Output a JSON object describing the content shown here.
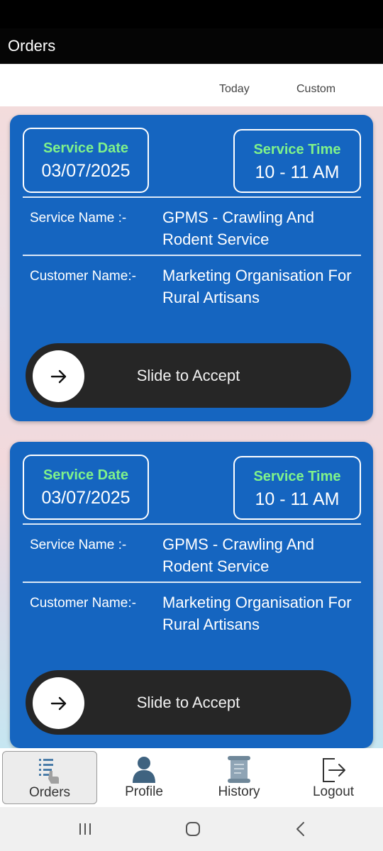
{
  "app_bar": {
    "title": "Orders"
  },
  "filters": {
    "today": "Today",
    "custom": "Custom"
  },
  "orders": [
    {
      "service_date_label": "Service Date",
      "service_date": "03/07/2025",
      "service_time_label": "Service Time",
      "service_time": "10 - 11 AM",
      "service_name_label": "Service Name :-",
      "service_name": "GPMS - Crawling And Rodent Service",
      "customer_name_label": "Customer Name:-",
      "customer_name": "Marketing Organisation For Rural Artisans",
      "slider_label": "Slide to Accept",
      "slider_icon": "arrow-right-icon"
    },
    {
      "service_date_label": "Service Date",
      "service_date": "03/07/2025",
      "service_time_label": "Service Time",
      "service_time": "10 - 11 AM",
      "service_name_label": "Service Name :-",
      "service_name": "GPMS - Crawling And Rodent Service",
      "customer_name_label": "Customer Name:-",
      "customer_name": "Marketing Organisation For Rural Artisans",
      "slider_label": "Slide to Accept",
      "slider_icon": "arrow-right-icon"
    }
  ],
  "bottom_nav": {
    "items": [
      {
        "label": "Orders",
        "icon": "orders-list-icon",
        "active": true
      },
      {
        "label": "Profile",
        "icon": "person-icon",
        "active": false
      },
      {
        "label": "History",
        "icon": "scroll-icon",
        "active": false
      },
      {
        "label": "Logout",
        "icon": "logout-icon",
        "active": false
      }
    ]
  },
  "system_nav": {
    "recent": "recent-apps-icon",
    "home": "home-icon",
    "back": "back-icon"
  },
  "colors": {
    "card": "#1565c0",
    "label_green": "#7ff28a",
    "slider": "#262626",
    "app_bar": "#050505"
  }
}
